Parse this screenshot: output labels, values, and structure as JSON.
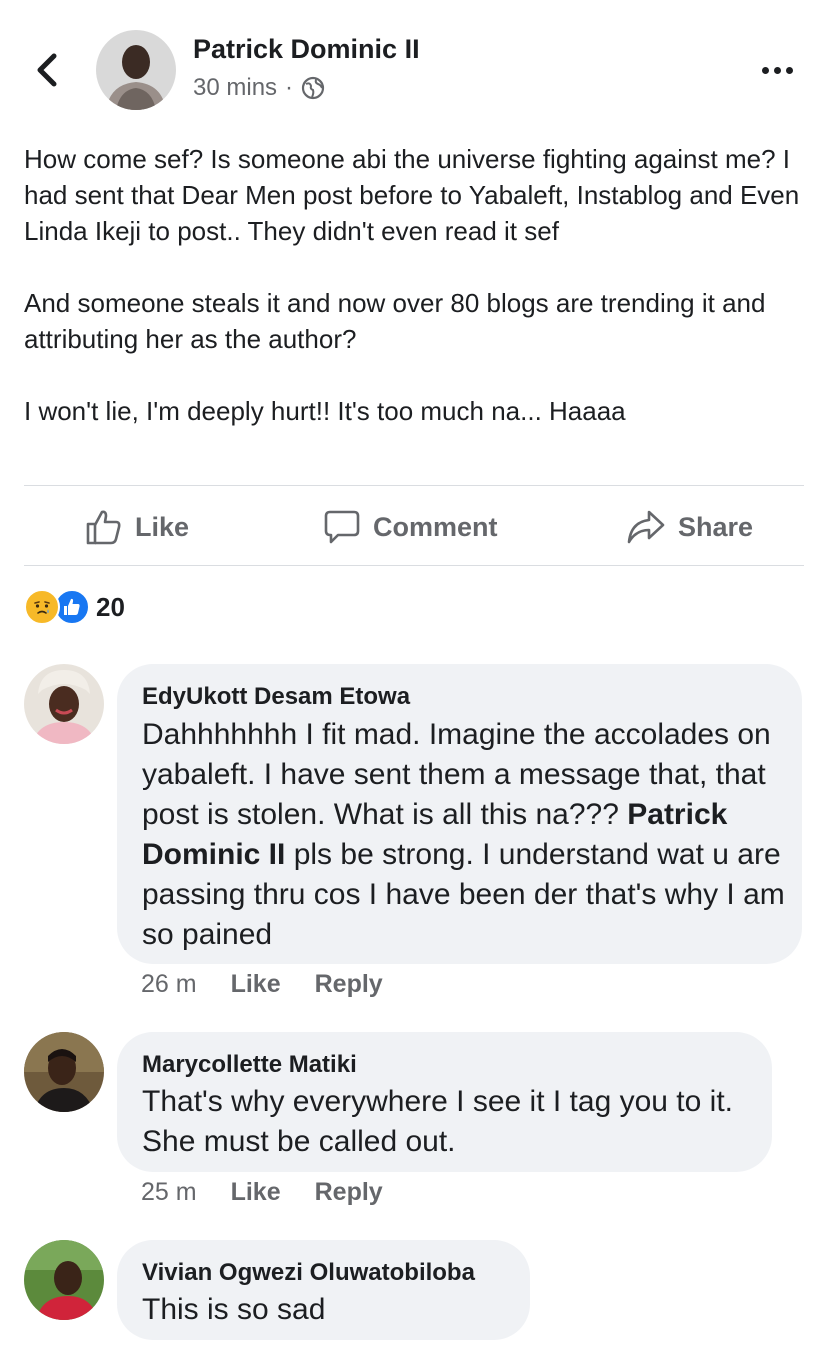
{
  "post": {
    "author": "Patrick Dominic II",
    "time": "30 mins",
    "separator": "·",
    "body": [
      "How come sef? Is someone abi the universe fighting against me?  I had sent that Dear Men post before to Yabaleft, Instablog and Even Linda Ikeji to post.. They didn't even read it sef",
      "And someone steals it and now over 80 blogs are trending it and attributing her as the author?",
      "I won't lie, I'm deeply hurt!!  It's too much na... Haaaa"
    ]
  },
  "actions": {
    "like": "Like",
    "comment": "Comment",
    "share": "Share"
  },
  "reactions": {
    "count": "20",
    "icons": [
      "sad-face-icon",
      "thumbs-up-icon"
    ]
  },
  "comments": [
    {
      "name": "EdyUkott Desam Etowa",
      "text_before": "Dahhhhhhh I fit mad. Imagine the accolades on yabaleft. I have sent them a message that, that post is stolen. What is all this na??? ",
      "mention": "Patrick Dominic II",
      "text_after": " pls be strong. I understand wat u are passing thru cos I have been der that's why I am so pained",
      "time": "26 m",
      "like": "Like",
      "reply": "Reply"
    },
    {
      "name": "Marycollette Matiki",
      "text": "That's why everywhere I see it I tag you to it. She must be called out.",
      "time": "25 m",
      "like": "Like",
      "reply": "Reply"
    },
    {
      "name": "Vivian Ogwezi Oluwatobiloba",
      "text": "This is so sad"
    }
  ],
  "colors": {
    "text": "#1c1e21",
    "secondary": "#65676b",
    "bubble": "#f0f2f5",
    "like_blue": "#1877f2",
    "sad_yellow": "#f7b928"
  }
}
